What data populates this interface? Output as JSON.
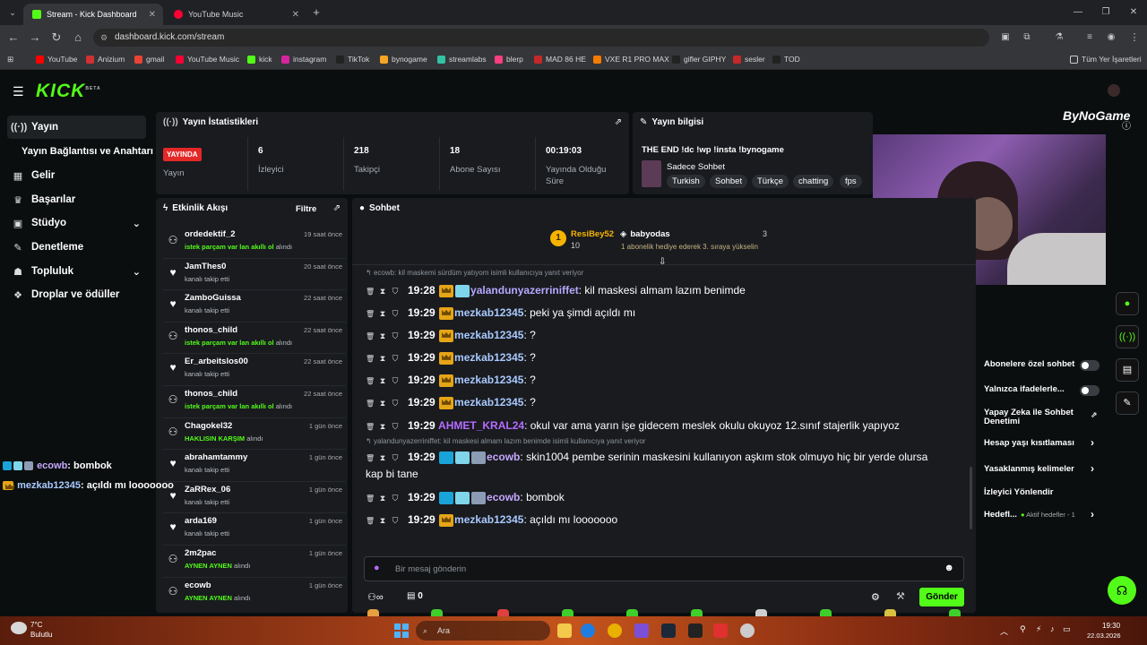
{
  "browser": {
    "tabs": [
      {
        "label": "Stream - Kick Dashboard",
        "active": true,
        "favicon_color": "#53fc18"
      },
      {
        "label": "YouTube Music",
        "active": false,
        "favicon_color": "#ff0033"
      }
    ],
    "url": "dashboard.kick.com/stream",
    "bookmarks": [
      {
        "label": "YouTube",
        "color": "#ff0000"
      },
      {
        "label": "Anizium",
        "color": "#d23131"
      },
      {
        "label": "gmail",
        "color": "#ea4335"
      },
      {
        "label": "YouTube Music",
        "color": "#ff0033"
      },
      {
        "label": "kick",
        "color": "#53fc18"
      },
      {
        "label": "instagram",
        "color": "#d6249f"
      },
      {
        "label": "TikTok",
        "color": "#222222"
      },
      {
        "label": "bynogame",
        "color": "#f5a623"
      },
      {
        "label": "streamlabs",
        "color": "#31c3a2"
      },
      {
        "label": "blerp",
        "color": "#ff3e7f"
      },
      {
        "label": "MAD 86 HE",
        "color": "#c62828"
      },
      {
        "label": "VXE R1 PRO MAX",
        "color": "#f57c00"
      },
      {
        "label": "gifler GIPHY",
        "color": "#222222"
      },
      {
        "label": "sesler",
        "color": "#c62828"
      },
      {
        "label": "TOD",
        "color": "#222222"
      }
    ],
    "all_bookmarks_label": "Tüm Yer İşaretleri"
  },
  "brand": {
    "logo": "KICK",
    "beta": "BETA",
    "accent": "#53fc18"
  },
  "sidebar": {
    "items": [
      {
        "label": "Yayın",
        "icon": "broadcast-icon",
        "glyph": "((·))"
      },
      {
        "label": "Yayın Bağlantısı ve Anahtarı",
        "icon": "",
        "glyph": ""
      },
      {
        "label": "Gelir",
        "icon": "revenue-icon",
        "glyph": "▦"
      },
      {
        "label": "Başarılar",
        "icon": "trophy-icon",
        "glyph": "♛"
      },
      {
        "label": "Stüdyo",
        "icon": "studio-icon",
        "glyph": "▣"
      },
      {
        "label": "Denetleme",
        "icon": "wrench-icon",
        "glyph": "✎"
      },
      {
        "label": "Topluluk",
        "icon": "community-icon",
        "glyph": "👥"
      },
      {
        "label": "Droplar ve ödüller",
        "icon": "gift-icon",
        "glyph": "🎁"
      }
    ]
  },
  "stats": {
    "title": "Yayın İstatistikleri",
    "live_badge": "YAYINDA",
    "live_label": "Yayın",
    "viewers": {
      "value": "6",
      "label": "İzleyici"
    },
    "followers": {
      "value": "218",
      "label": "Takipçi"
    },
    "subs": {
      "value": "18",
      "label": "Abone Sayısı"
    },
    "uptime": {
      "value": "00:19:03",
      "label": "Yayında Olduğu Süre"
    }
  },
  "stream_info": {
    "title": "Yayın bilgisi",
    "stream_title": "THE END !dc !wp !insta !bynogame",
    "category": "Sadece Sohbet",
    "tags": [
      "Turkish",
      "Sohbet",
      "Türkçe",
      "chatting",
      "fps"
    ]
  },
  "activity": {
    "title": "Etkinlik Akışı",
    "filter": "Filtre",
    "items": [
      {
        "name": "ordedektif_2",
        "time": "19 saat önce",
        "type": "redeem",
        "sub_prefix": "istek parçam var lan akıllı ol",
        "sub_suffix": "alındı"
      },
      {
        "name": "JamThes0",
        "time": "20 saat önce",
        "type": "follow",
        "sub_prefix": "",
        "sub_suffix": "kanalı takip etti"
      },
      {
        "name": "ZamboGuissa",
        "time": "22 saat önce",
        "type": "follow",
        "sub_prefix": "",
        "sub_suffix": "kanalı takip etti"
      },
      {
        "name": "thonos_child",
        "time": "22 saat önce",
        "type": "redeem",
        "sub_prefix": "istek parçam var lan akıllı ol",
        "sub_suffix": "alındı"
      },
      {
        "name": "Er_arbeitslos00",
        "time": "22 saat önce",
        "type": "follow",
        "sub_prefix": "",
        "sub_suffix": "kanalı takip etti"
      },
      {
        "name": "thonos_child",
        "time": "22 saat önce",
        "type": "redeem",
        "sub_prefix": "istek parçam var lan akıllı ol",
        "sub_suffix": "alındı"
      },
      {
        "name": "Chagokel32",
        "time": "1 gün önce",
        "type": "redeem",
        "sub_prefix": "HAKLISIN KARŞIM",
        "sub_suffix": "alındı"
      },
      {
        "name": "abrahamtammy",
        "time": "1 gün önce",
        "type": "follow",
        "sub_prefix": "",
        "sub_suffix": "kanalı takip etti"
      },
      {
        "name": "ZaRRex_06",
        "time": "1 gün önce",
        "type": "follow",
        "sub_prefix": "",
        "sub_suffix": "kanalı takip etti"
      },
      {
        "name": "arda169",
        "time": "1 gün önce",
        "type": "follow",
        "sub_prefix": "",
        "sub_suffix": "kanalı takip etti"
      },
      {
        "name": "2m2pac",
        "time": "1 gün önce",
        "type": "redeem",
        "sub_prefix": "AYNEN AYNEN",
        "sub_suffix": "alındı"
      },
      {
        "name": "ecowb",
        "time": "1 gün önce",
        "type": "redeem",
        "sub_prefix": "AYNEN AYNEN",
        "sub_suffix": "alındı"
      }
    ]
  },
  "chat": {
    "title": "Sohbet",
    "leaderboard": {
      "top_user": "ResiBey52",
      "top_count": "10",
      "second_user": "babyodas",
      "second_count": "3",
      "gift_note": "1 abonelik hediye ederek 3. sıraya yükselin"
    },
    "messages": [
      {
        "reply": "ecowb: kil maskemi sürdüm yatıyom isimli kullanıcıya yanıt veriyor",
        "time": "19:28",
        "badges": [
          "crown",
          "sub"
        ],
        "user": "yalandunyazerriniffet",
        "color": "#b6a8ff",
        "text": "kil maskesi almam lazım benimde"
      },
      {
        "reply": "",
        "time": "19:29",
        "badges": [
          "crown"
        ],
        "user": "mezkab12345",
        "color": "#a9c9ff",
        "text": "peki ya şimdi açıldı mı"
      },
      {
        "reply": "",
        "time": "19:29",
        "badges": [
          "crown"
        ],
        "user": "mezkab12345",
        "color": "#a9c9ff",
        "text": "?"
      },
      {
        "reply": "",
        "time": "19:29",
        "badges": [
          "crown"
        ],
        "user": "mezkab12345",
        "color": "#a9c9ff",
        "text": "?"
      },
      {
        "reply": "",
        "time": "19:29",
        "badges": [
          "crown"
        ],
        "user": "mezkab12345",
        "color": "#a9c9ff",
        "text": "?"
      },
      {
        "reply": "",
        "time": "19:29",
        "badges": [
          "crown"
        ],
        "user": "mezkab12345",
        "color": "#a9c9ff",
        "text": "?"
      },
      {
        "reply": "",
        "time": "19:29",
        "badges": [],
        "user": "AHMET_KRAL24",
        "color": "#b56cff",
        "text": "okul var ama yarın işe gidecem meslek okulu okuyoz 12.sınıf stajerlik yapıyoz"
      },
      {
        "reply": "yalandunyazerriniffet: kil maskesi almam lazım benimde isimli kullanıcıya yanıt veriyor",
        "time": "19:29",
        "badges": [
          "vip",
          "sub",
          "avatar"
        ],
        "user": "ecowb",
        "color": "#c5a7ff",
        "text": "skin1004 pembe serinin maskesini kullanıyon aşkım stok olmuyo hiç bir yerde olursa",
        "text2": "kap bi tane"
      },
      {
        "reply": "",
        "time": "19:29",
        "badges": [
          "vip",
          "sub",
          "avatar"
        ],
        "user": "ecowb",
        "color": "#c5a7ff",
        "text": "bombok"
      },
      {
        "reply": "",
        "time": "19:29",
        "badges": [
          "crown"
        ],
        "user": "mezkab12345",
        "color": "#a9c9ff",
        "text": "açıldı mı looooooo"
      }
    ],
    "input_placeholder": "Bir mesaj gönderin",
    "points": "0",
    "send_label": "Gönder"
  },
  "overlay": {
    "lines": [
      {
        "user": "ecowb",
        "text": ": bombok"
      },
      {
        "user": "mezkab12345",
        "text": ": açıldı mı looooooo"
      }
    ],
    "watermark": "ByNoGame"
  },
  "mod_settings": {
    "items": [
      {
        "label": "Abonelere özel sohbet",
        "control": "toggle"
      },
      {
        "label": "Yalnızca ifadelerle...",
        "control": "toggle"
      },
      {
        "label": "Yapay Zeka ile Sohbet Denetimi",
        "control": "external"
      },
      {
        "label": "Hesap yaşı kısıtlaması",
        "control": "chevron"
      },
      {
        "label": "Yasaklanmış kelimeler",
        "control": "chevron"
      },
      {
        "label": "İzleyici Yönlendir",
        "control": "none"
      },
      {
        "label": "Hedefl...",
        "control": "chevron",
        "extra": "Aktif hedefler - 1"
      }
    ]
  },
  "taskbar": {
    "weather_temp": "7°C",
    "weather_text": "Bulutlu",
    "search": "Ara",
    "time": "19:30",
    "date": "22.03.2026"
  }
}
